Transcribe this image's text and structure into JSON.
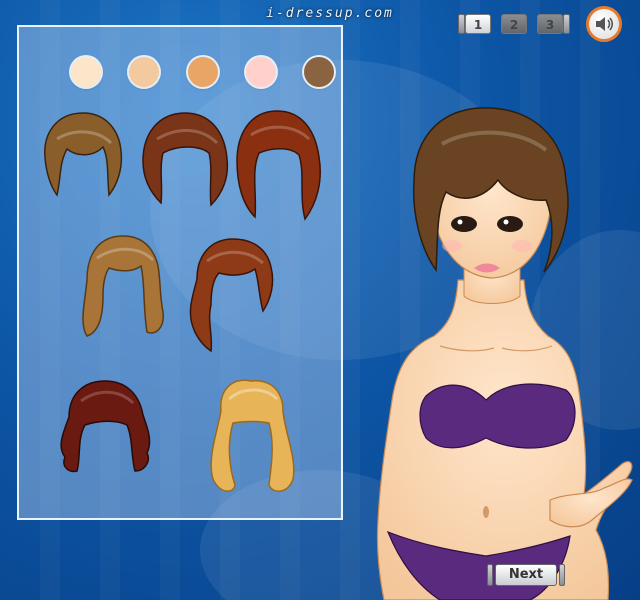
{
  "brand": {
    "text": "i-dressup.com"
  },
  "pager": {
    "pages": [
      "1",
      "2",
      "3"
    ],
    "active_page": "1"
  },
  "sound": {
    "icon": "speaker-icon"
  },
  "panel": {
    "skin_tones": [
      "#fce5c9",
      "#f3c9a0",
      "#e9a566",
      "#ffd0cc",
      "#8a6440"
    ],
    "hair_colors": [
      "#8a5e2a",
      "#7a3418",
      "#8a3010",
      "#a87438",
      "#8f3a16",
      "#6a1a10",
      "#e8b458"
    ]
  },
  "model": {
    "top_color": "#5a2a7e",
    "bottom_color": "#5a2a7e",
    "hair_color": "#6a4422"
  },
  "next_button": {
    "label": "Next"
  },
  "colors": {
    "accent": "#e87a2a",
    "background": "#0d56a6"
  }
}
